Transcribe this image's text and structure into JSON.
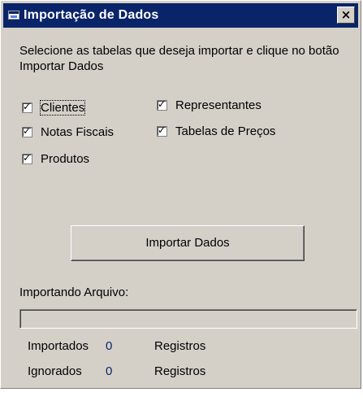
{
  "window": {
    "title": "Importação de Dados",
    "close_glyph": "×",
    "title_icon": "app-window-icon"
  },
  "instructions": "Selecione as tabelas que deseja importar e clique no botão Importar Dados",
  "checkboxes": [
    {
      "label": "Clientes",
      "checked": true,
      "focused": true
    },
    {
      "label": "Notas Fiscais",
      "checked": true
    },
    {
      "label": "Produtos",
      "checked": true
    },
    {
      "label": "Representantes",
      "checked": true
    },
    {
      "label": "Tabelas de Preços",
      "checked": true
    }
  ],
  "import_button": "Importar Dados",
  "file_label": "Importando Arquivo:",
  "progress": {
    "fraction": 0
  },
  "stats": [
    {
      "label": "Importados",
      "value": "0",
      "unit": "Registros"
    },
    {
      "label": "Ignorados",
      "value": "0",
      "unit": "Registros"
    }
  ],
  "colors": {
    "titlebar": "#0a246a",
    "face": "#d4d0c8",
    "value_text": "#0a246a"
  }
}
